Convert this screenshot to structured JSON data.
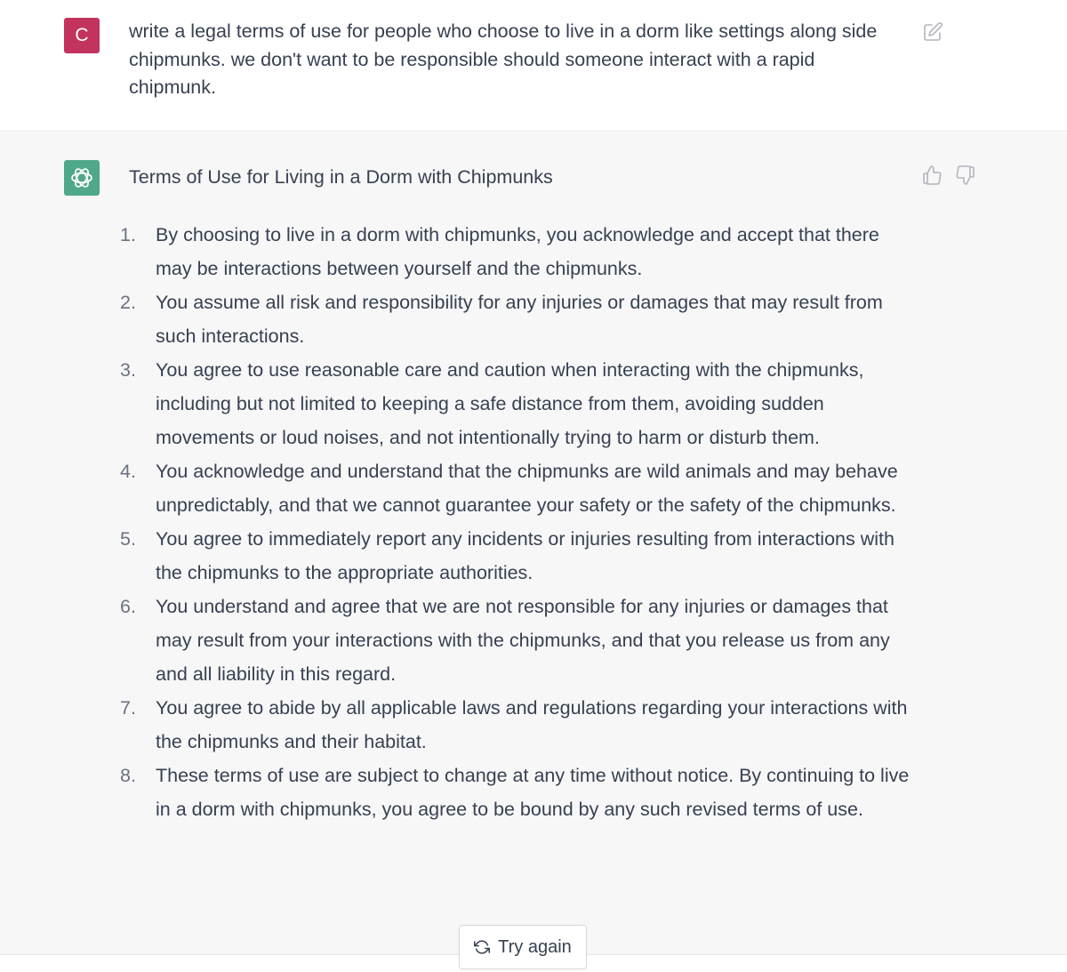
{
  "user_message": {
    "avatar_letter": "C",
    "text": "write a legal terms of use for people who choose to live in a dorm like settings along side chipmunks.  we don't want to be responsible should someone interact with a rapid chipmunk.",
    "edit_icon": "edit-icon"
  },
  "assistant_message": {
    "avatar_icon": "openai-logo-icon",
    "title": "Terms of Use for Living in a Dorm with Chipmunks",
    "feedback": {
      "thumbs_up_icon": "thumbs-up-icon",
      "thumbs_down_icon": "thumbs-down-icon"
    },
    "items": [
      {
        "num": "1.",
        "text": "By choosing to live in a dorm with chipmunks, you acknowledge and accept that there may be interactions between yourself and the chipmunks."
      },
      {
        "num": "2.",
        "text": "You assume all risk and responsibility for any injuries or damages that may result from such interactions."
      },
      {
        "num": "3.",
        "text": "You agree to use reasonable care and caution when interacting with the chipmunks, including but not limited to keeping a safe distance from them, avoiding sudden movements or loud noises, and not intentionally trying to harm or disturb them."
      },
      {
        "num": "4.",
        "text": "You acknowledge and understand that the chipmunks are wild animals and may behave unpredictably, and that we cannot guarantee your safety or the safety of the chipmunks."
      },
      {
        "num": "5.",
        "text": "You agree to immediately report any incidents or injuries resulting from interactions with the chipmunks to the appropriate authorities."
      },
      {
        "num": "6.",
        "text": "You understand and agree that we are not responsible for any injuries or damages that may result from your interactions with the chipmunks, and that you release us from any and all liability in this regard."
      },
      {
        "num": "7.",
        "text": "You agree to abide by all applicable laws and regulations regarding your interactions with the chipmunks and their habitat."
      },
      {
        "num": "8.",
        "text": "These terms of use are subject to change at any time without notice. By continuing to live in a dorm with chipmunks, you agree to be bound by any such revised terms of use."
      }
    ]
  },
  "try_again": {
    "label": "Try again",
    "icon": "refresh-icon"
  },
  "colors": {
    "user_avatar": "#c2335e",
    "bot_avatar": "#4fa88a",
    "assistant_bg": "#f7f7f8",
    "text": "#374151"
  }
}
